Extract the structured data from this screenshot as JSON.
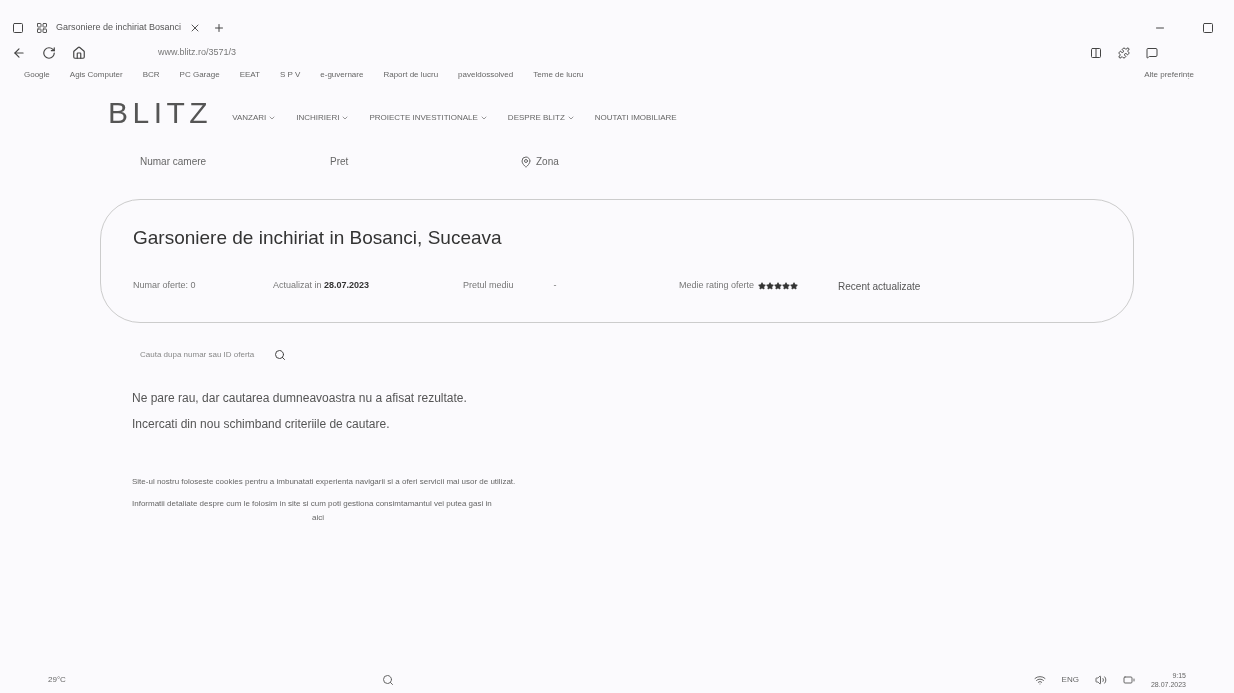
{
  "browser": {
    "tab_title": "Garsoniere de inchiriat Bosanci",
    "url": "www.blitz.ro/3571/3",
    "bookmarks": [
      "Google",
      "Agis Computer",
      "BCR",
      "PC Garage",
      "EEAT",
      "S P V",
      "e-guvernare",
      "Raport de lucru",
      "paveldossolved",
      "Teme de lucru"
    ],
    "other_bookmarks": "Alte preferințe"
  },
  "site": {
    "logo": "BLITZ",
    "nav": [
      "VANZARI",
      "INCHIRIERI",
      "PROIECTE INVESTITIONALE",
      "DESPRE BLITZ",
      "NOUTATI IMOBILIARE"
    ],
    "filters": [
      {
        "label": "Numar camere",
        "kind": "plain"
      },
      {
        "label": "Pret",
        "kind": "plain"
      },
      {
        "label": "Zona",
        "kind": "location"
      }
    ],
    "heading": "Garsoniere de inchiriat in Bosanci, Suceava",
    "stats": {
      "offers_label": "Numar oferte:",
      "offers": "0",
      "updated_label": "Actualizat in",
      "updated": "28.07.2023",
      "price_label": "Pretul mediu",
      "price_value": "-",
      "rating_label": "Medie rating oferte",
      "stars": 5,
      "sort": "Recent actualizate"
    },
    "search": {
      "placeholder": "Cauta dupa numar sau ID oferta"
    },
    "messages": [
      "Ne pare rau, dar cautarea dumneavoastra nu a afisat rezultate.",
      "Incercati din nou schimband criteriile de cautare."
    ],
    "cookie": {
      "lines": [
        "Site-ul nostru foloseste cookies pentru a imbunatati experienta navigarii si a oferi servicii mai usor de utilizat.",
        "Informatii detaliate despre cum le folosim in site si cum poti gestiona consimtamantul vei putea gasi in"
      ],
      "link": "aici"
    }
  },
  "taskbar": {
    "weather": "29°C",
    "language": "ENG",
    "time": "9:15",
    "date": "28.07.2023"
  }
}
